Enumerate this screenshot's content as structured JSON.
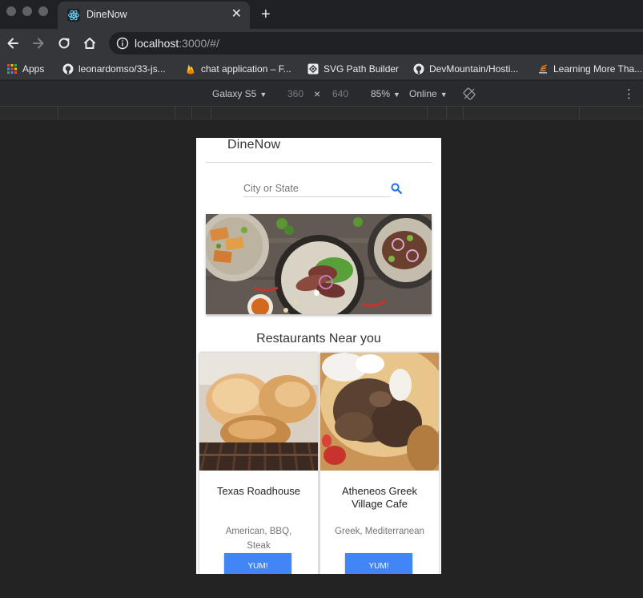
{
  "browser": {
    "tab": {
      "title": "DineNow",
      "favicon": "react-icon",
      "close": "✕"
    },
    "new_tab": "+",
    "address": {
      "host": "localhost",
      "rest": ":3000/#/"
    },
    "bookmarks": [
      {
        "label": "Apps",
        "icon": "apps-grid-icon"
      },
      {
        "label": "leonardomso/33-js...",
        "icon": "github-icon"
      },
      {
        "label": "chat application – F...",
        "icon": "firebase-icon"
      },
      {
        "label": "SVG Path Builder",
        "icon": "svg-path-icon"
      },
      {
        "label": "DevMountain/Hosti...",
        "icon": "github-icon"
      },
      {
        "label": "Learning More Tha...",
        "icon": "stackoverflow-icon"
      }
    ]
  },
  "devtools": {
    "device": "Galaxy S5",
    "width": "360",
    "times": "×",
    "height": "640",
    "zoom": "85%",
    "network": "Online",
    "more": "⋮"
  },
  "app": {
    "title": "DineNow",
    "search_placeholder": "City or State",
    "section_title": "Restaurants Near you",
    "restaurants": [
      {
        "name": "Texas Roadhouse",
        "cuisine": "American, BBQ, Steak",
        "button": "YUM!"
      },
      {
        "name": "Atheneos Greek Village Cafe",
        "cuisine": "Greek, Mediterranean",
        "button": "YUM!"
      }
    ],
    "accent_color": "#4285f4"
  }
}
